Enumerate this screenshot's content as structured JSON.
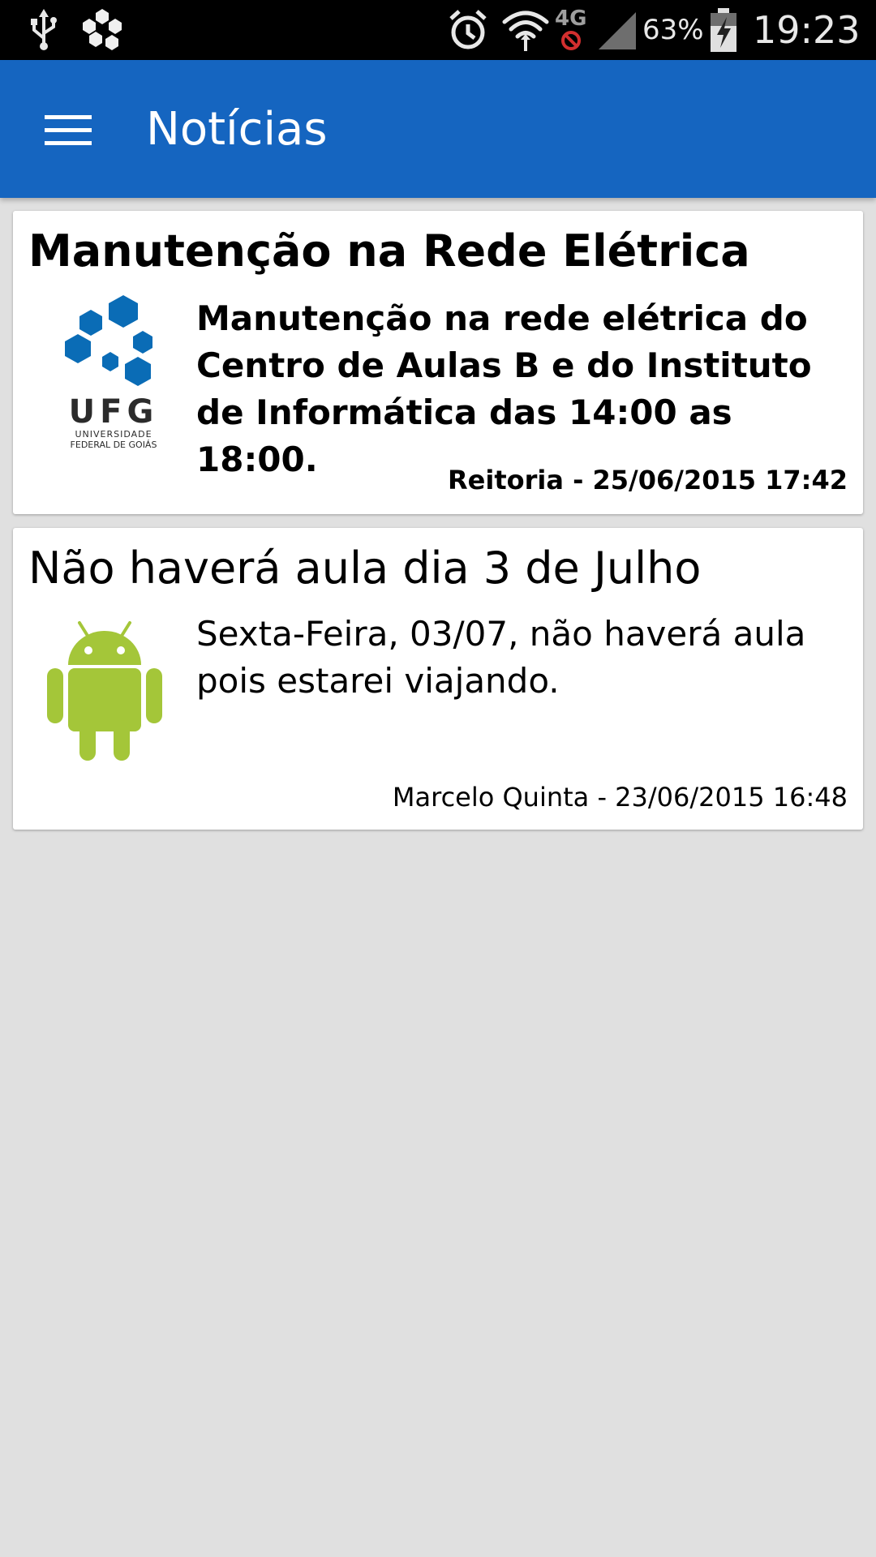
{
  "status_bar": {
    "battery_percent": "63%",
    "time": "19:23",
    "network": "4G",
    "icons": [
      "usb-icon",
      "app-notification-icon",
      "alarm-icon",
      "wifi-icon",
      "mobile-data-icon",
      "signal-icon",
      "battery-charging-icon"
    ]
  },
  "app_bar": {
    "title": "Notícias",
    "background_color": "#1565c0",
    "menu_icon": "menu-icon"
  },
  "news": [
    {
      "title": "Manutenção na Rede Elétrica",
      "body": "Manutenção na rede elétrica do Centro de Aulas B e do Instituto de Informática das 14:00 as 18:00.",
      "meta": "Reitoria - 25/06/2015 17:42",
      "image": "ufg-logo",
      "logo_text": "UFG",
      "logo_subtext_1": "UNIVERSIDADE",
      "logo_subtext_2": "FEDERAL DE GOIÁS",
      "bold": true
    },
    {
      "title": "Não haverá aula dia 3 de Julho",
      "body": "Sexta-Feira, 03/07, não haverá aula pois estarei viajando.",
      "meta": "Marcelo Quinta - 23/06/2015 16:48",
      "image": "android-icon",
      "bold": false
    }
  ],
  "colors": {
    "ufg_blue": "#0a6cb6",
    "android_green": "#a4c639",
    "page_background": "#e0e0e0"
  }
}
